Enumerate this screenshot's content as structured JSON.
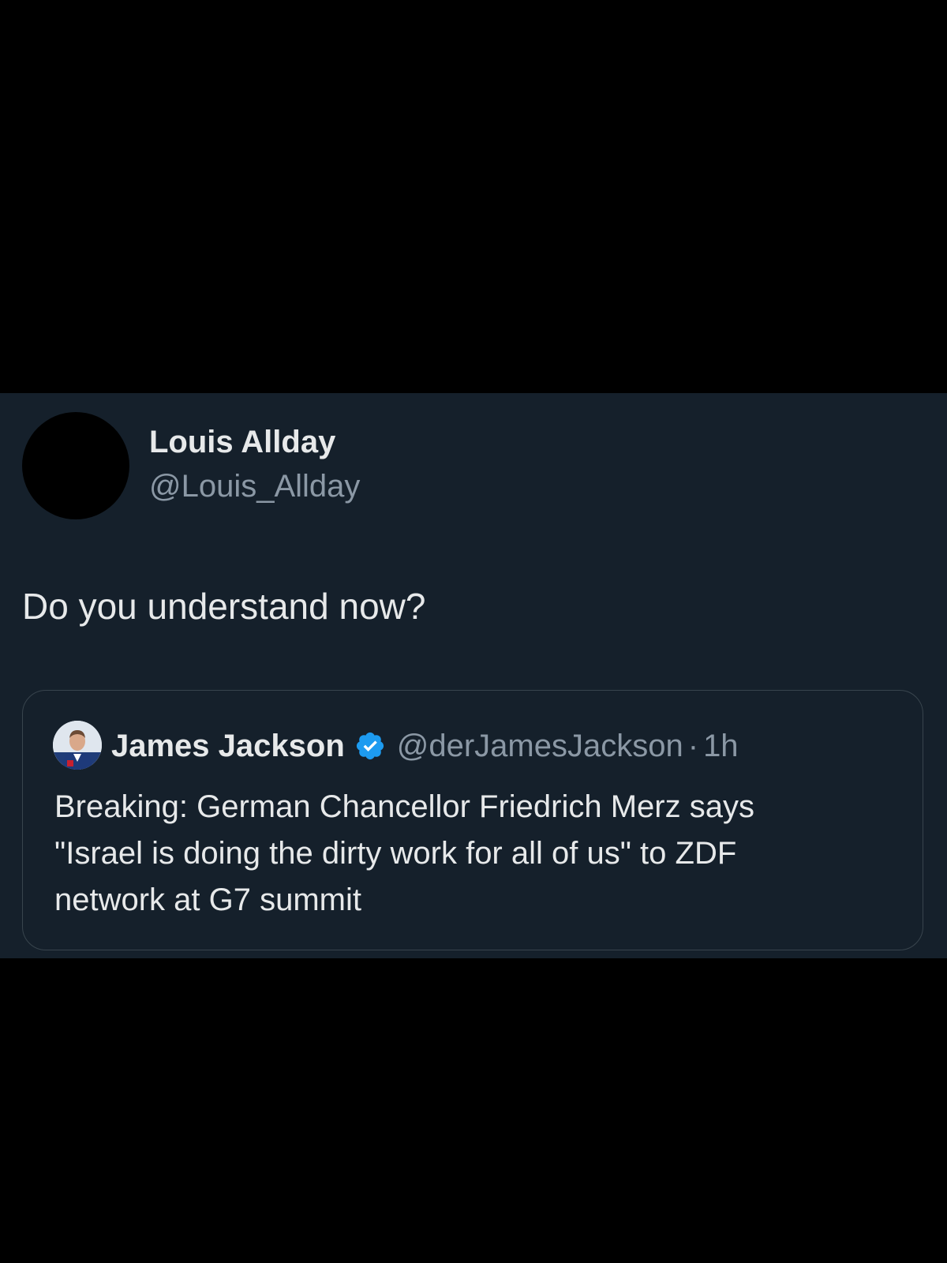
{
  "tweet": {
    "author_name": "Louis Allday",
    "author_handle": "@Louis_Allday",
    "text": "Do you understand now?",
    "avatar_color": "#000000"
  },
  "quoted_tweet": {
    "author_name": "James Jackson",
    "author_handle": "@derJamesJackson",
    "separator": "·",
    "time": "1h",
    "verified_icon": "verified-badge-icon",
    "verified_color": "#1d9bf0",
    "text_lines": [
      "Breaking: German Chancellor Friedrich Merz says",
      "\"Israel is doing the dirty work for all of us\" to ZDF",
      "network at G7  summit"
    ]
  },
  "colors": {
    "background": "#000000",
    "card": "#15202b",
    "primary_text": "#e7e9ea",
    "secondary_text": "#8b98a5",
    "border": "#38444d"
  }
}
